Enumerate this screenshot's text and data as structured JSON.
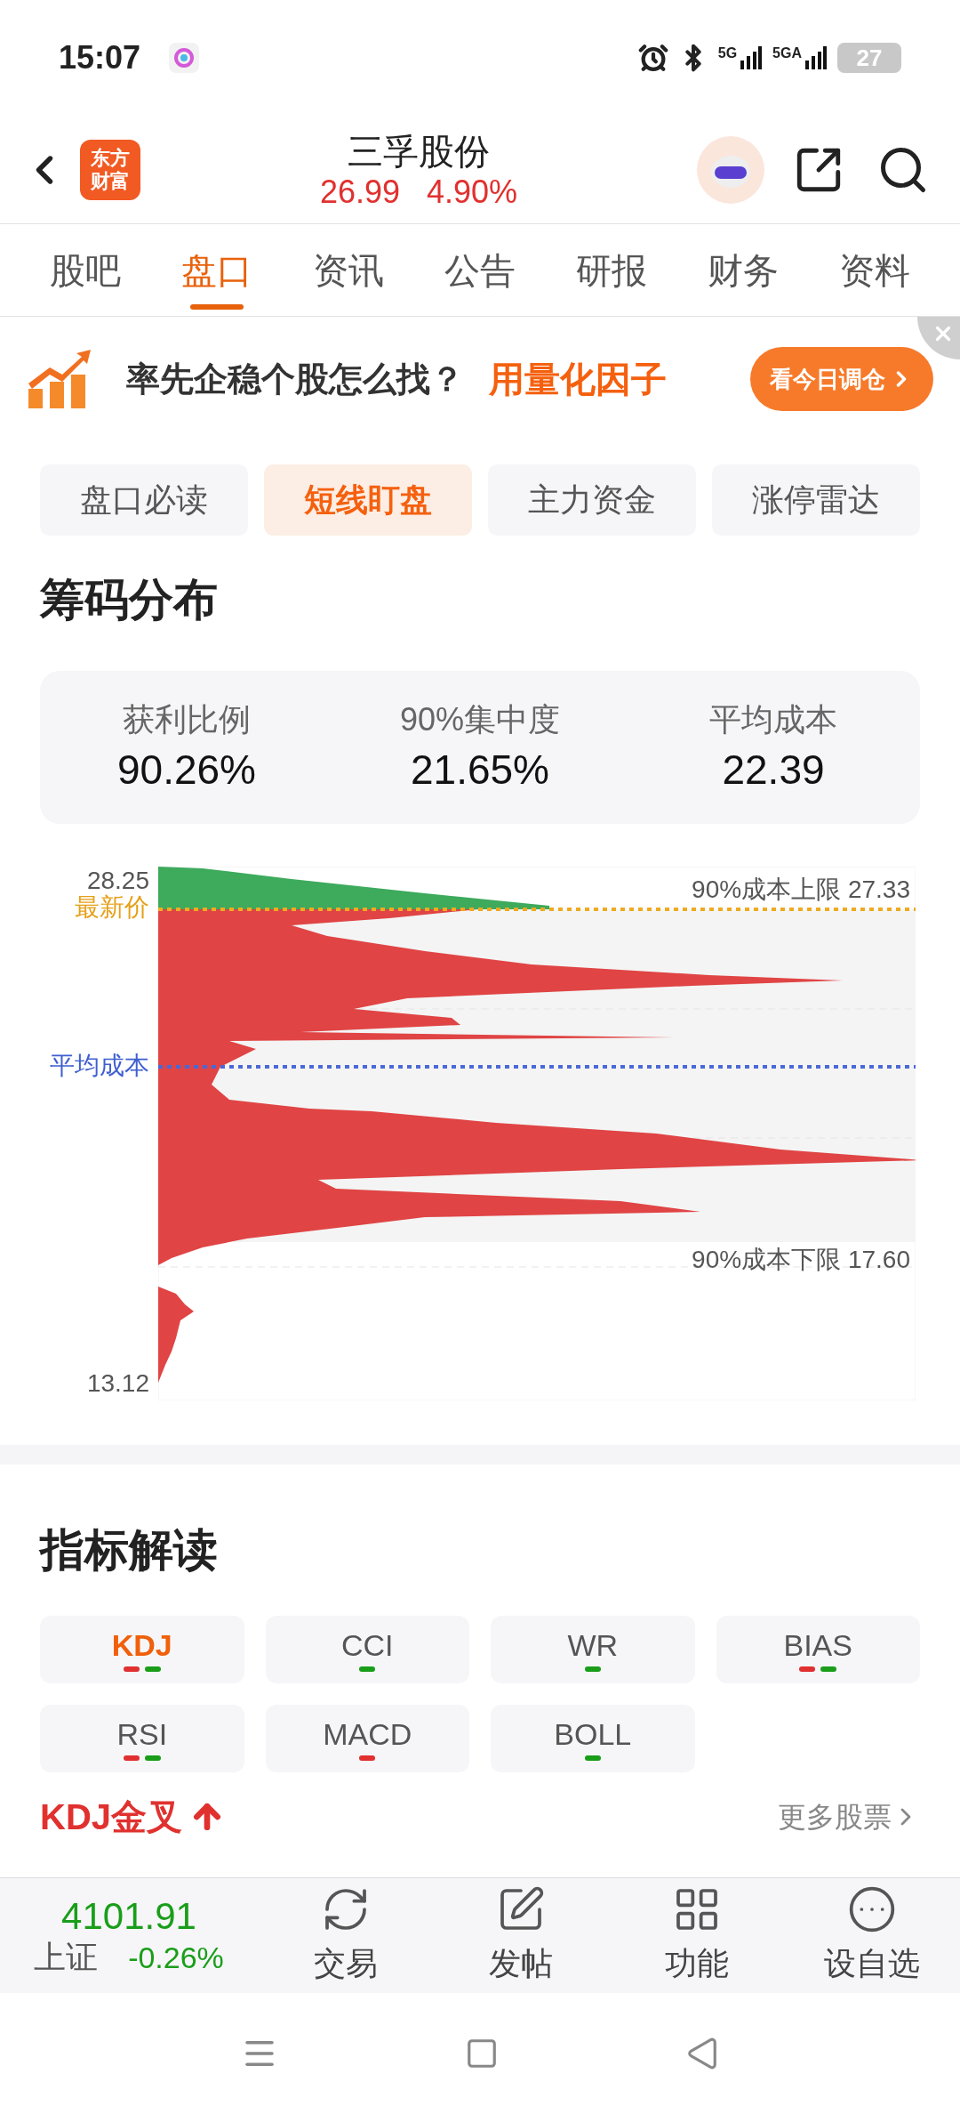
{
  "status_bar": {
    "time": "15:07",
    "network": [
      "5G",
      "5GA"
    ],
    "battery": "27"
  },
  "header": {
    "logo_lines": [
      "东方",
      "财富"
    ],
    "title": "三孚股份",
    "price": "26.99",
    "change": "4.90%"
  },
  "tabs": [
    {
      "label": "股吧",
      "selected": false
    },
    {
      "label": "盘口",
      "selected": true
    },
    {
      "label": "资讯",
      "selected": false
    },
    {
      "label": "公告",
      "selected": false
    },
    {
      "label": "研报",
      "selected": false
    },
    {
      "label": "财务",
      "selected": false
    },
    {
      "label": "资料",
      "selected": false
    }
  ],
  "banner": {
    "question": "率先企稳个股怎么找？",
    "highlight": "用量化因子",
    "button": "看今日调仓"
  },
  "sub_tabs": [
    {
      "label": "盘口必读",
      "selected": false
    },
    {
      "label": "短线盯盘",
      "selected": true
    },
    {
      "label": "主力资金",
      "selected": false
    },
    {
      "label": "涨停雷达",
      "selected": false
    }
  ],
  "chip_section": {
    "title": "筹码分布",
    "stats": [
      {
        "label": "获利比例",
        "value": "90.26%"
      },
      {
        "label": "90%集中度",
        "value": "21.65%"
      },
      {
        "label": "平均成本",
        "value": "22.39"
      }
    ],
    "chart": {
      "top_price": "28.25",
      "bottom_price": "13.12",
      "latest_label": "最新价",
      "avg_label": "平均成本",
      "upper_label": "90%成本上限 27.33",
      "lower_label": "90%成本下限 17.60"
    }
  },
  "indicator_section": {
    "title": "指标解读",
    "indicators": [
      {
        "label": "KDJ",
        "selected": true,
        "signals": [
          {
            "color": "#e03030"
          },
          {
            "color": "#1a9e1a"
          }
        ]
      },
      {
        "label": "CCI",
        "selected": false,
        "signals": [
          {
            "color": "#1a9e1a"
          }
        ]
      },
      {
        "label": "WR",
        "selected": false,
        "signals": [
          {
            "color": "#1a9e1a"
          }
        ]
      },
      {
        "label": "BIAS",
        "selected": false,
        "signals": [
          {
            "color": "#e03030"
          },
          {
            "color": "#1a9e1a"
          }
        ]
      },
      {
        "label": "RSI",
        "selected": false,
        "signals": [
          {
            "color": "#e03030"
          },
          {
            "color": "#1a9e1a"
          }
        ]
      },
      {
        "label": "MACD",
        "selected": false,
        "signals": [
          {
            "color": "#e03030"
          }
        ]
      },
      {
        "label": "BOLL",
        "selected": false,
        "signals": [
          {
            "color": "#1a9e1a"
          }
        ]
      }
    ],
    "signal": {
      "title": "KDJ金叉",
      "more": "更多股票"
    }
  },
  "bottom_bar": {
    "index_value": "4101.91",
    "index_name": "上证",
    "index_change": "-0.26%",
    "actions": [
      {
        "label": "交易"
      },
      {
        "label": "发帖"
      },
      {
        "label": "功能"
      },
      {
        "label": "设自选"
      }
    ]
  }
}
